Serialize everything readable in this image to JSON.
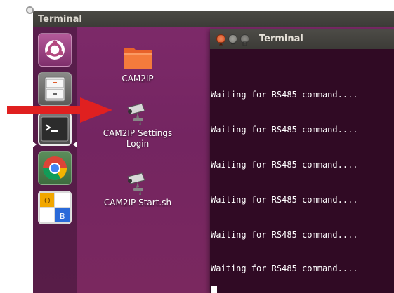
{
  "top_panel": {
    "title": "Terminal"
  },
  "desktop_icons": [
    {
      "label": "CAM2IP"
    },
    {
      "label_line1": "CAM2IP Settings",
      "label_line2": "Login"
    },
    {
      "label": "CAM2IP Start.sh"
    }
  ],
  "launcher": {
    "items": [
      "dash-home",
      "files",
      "terminal",
      "chrome",
      "office"
    ],
    "office_letters": {
      "a": "O",
      "b": "B"
    }
  },
  "terminal_window": {
    "title": "Terminal",
    "lines": [
      "Waiting for RS485 command....",
      "Waiting for RS485 command....",
      "Waiting for RS485 command....",
      "Waiting for RS485 command....",
      "Waiting for RS485 command....",
      "Waiting for RS485 command...."
    ]
  },
  "colors": {
    "desktop": "#772953",
    "terminal_bg": "#300a24",
    "arrow": "#e02020",
    "close_button": "#e05b2a"
  }
}
